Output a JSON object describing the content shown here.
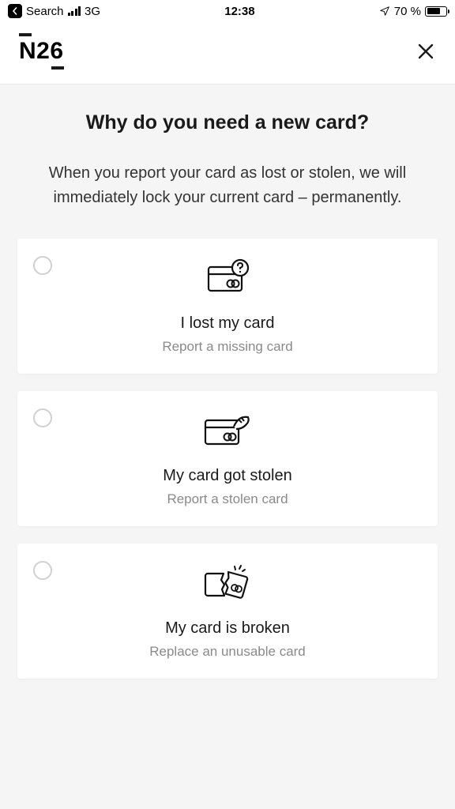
{
  "status_bar": {
    "search_label": "Search",
    "network_type": "3G",
    "time": "12:38",
    "battery_pct": "70 %"
  },
  "header": {
    "logo_text": "N26"
  },
  "page": {
    "title": "Why do you need a new card?",
    "subtitle": "When you report your card as lost or stolen, we will immediately lock your current card – permanently."
  },
  "options": [
    {
      "title": "I lost my card",
      "subtitle": "Report a missing card",
      "icon": "card-lost-icon"
    },
    {
      "title": "My card got stolen",
      "subtitle": "Report a stolen card",
      "icon": "card-stolen-icon"
    },
    {
      "title": "My card is broken",
      "subtitle": "Replace an unusable card",
      "icon": "card-broken-icon"
    }
  ]
}
